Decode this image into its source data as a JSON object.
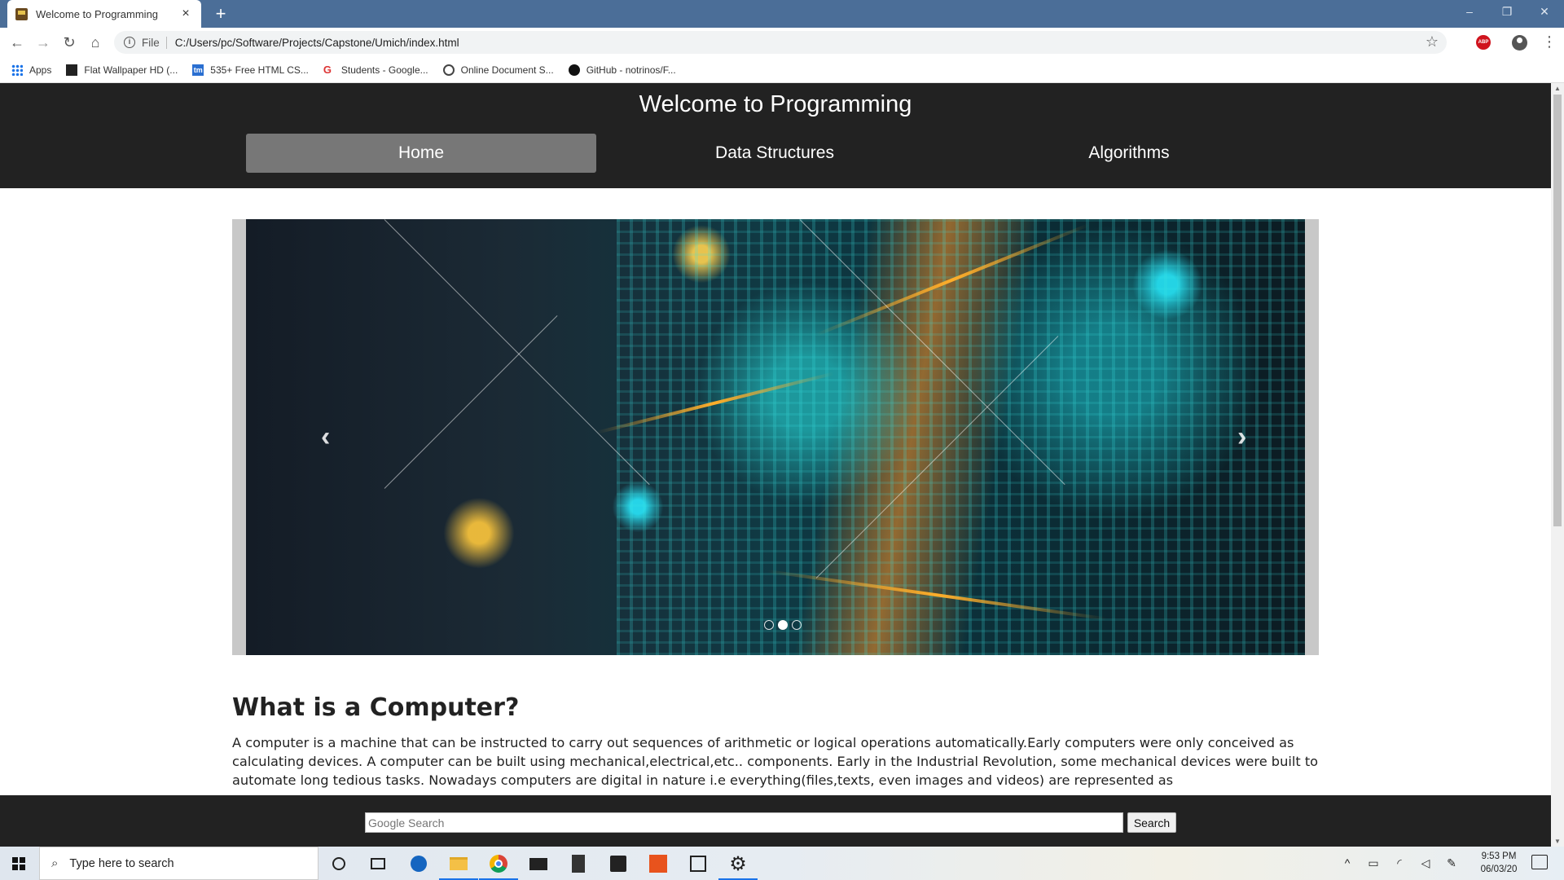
{
  "browser": {
    "tab_title": "Welcome to Programming",
    "tab_close": "×",
    "new_tab": "+",
    "window_controls": {
      "minimize": "–",
      "restore": "❐",
      "close": "✕"
    },
    "nav": {
      "back": "←",
      "forward": "→",
      "reload": "↻",
      "home": "⌂"
    },
    "address": {
      "scheme_label": "File",
      "url": "C:/Users/pc/Software/Projects/Capstone/Umich/index.html"
    },
    "star": "☆",
    "abp_label": "ABP",
    "menu": "⋮",
    "bookmarks": [
      {
        "label": "Apps",
        "icon": "apps-grid-icon"
      },
      {
        "label": "Flat Wallpaper HD (...",
        "icon": "wallpaper-icon"
      },
      {
        "label": "535+ Free HTML CS...",
        "icon": "tm-icon"
      },
      {
        "label": "Students - Google...",
        "icon": "google-icon"
      },
      {
        "label": "Online Document S...",
        "icon": "globe-icon"
      },
      {
        "label": "GitHub - notrinos/F...",
        "icon": "github-icon"
      }
    ]
  },
  "site": {
    "title": "Welcome to Programming",
    "nav": [
      {
        "label": "Home",
        "active": true
      },
      {
        "label": "Data Structures",
        "active": false
      },
      {
        "label": "Algorithms",
        "active": false
      }
    ],
    "carousel": {
      "prev": "‹",
      "next": "›",
      "slides": 3,
      "active_index": 1
    },
    "section": {
      "title": "What is a Computer?",
      "body": "A computer is a machine that can be instructed to carry out sequences of arithmetic or logical operations automatically.Early computers were only conceived as calculating devices. A computer can be built using mechanical,electrical,etc.. components. Early in the Industrial Revolution, some mechanical devices were built to automate long tedious tasks. Nowadays computers are digital in nature i.e everything(files,texts, even images and videos) are represented as"
    },
    "footer": {
      "search_placeholder": "Google Search",
      "search_value": "",
      "search_button": "Search"
    }
  },
  "taskbar": {
    "search_placeholder": "Type here to search",
    "time": "9:53 PM",
    "date": "06/03/20",
    "icons": [
      "cortana-icon",
      "task-view-icon",
      "edge-icon",
      "file-explorer-icon",
      "chrome-icon",
      "mail-icon",
      "calculator-icon",
      "store-icon",
      "office-icon",
      "calendar-icon",
      "settings-icon"
    ]
  },
  "colors": {
    "titlebar": "#4b6e98",
    "site_header": "#222222",
    "nav_active": "#777777"
  }
}
